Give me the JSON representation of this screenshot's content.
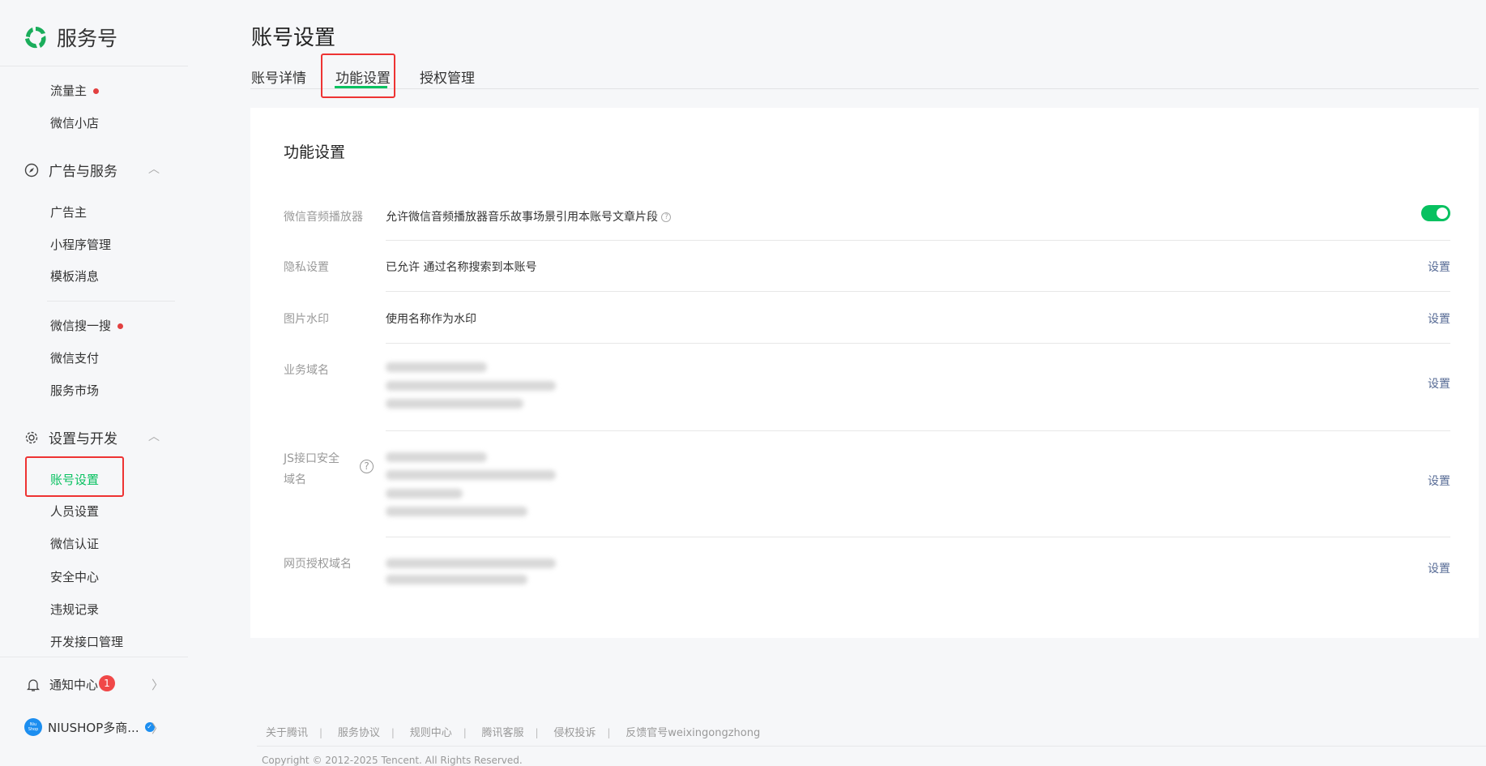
{
  "sidebar": {
    "brand": "服务号",
    "items_top": [
      {
        "label": "流量主",
        "dot": true
      },
      {
        "label": "微信小店"
      }
    ],
    "group_ads": {
      "label": "广告与服务",
      "items": [
        {
          "label": "广告主"
        },
        {
          "label": "小程序管理"
        },
        {
          "label": "模板消息"
        },
        {
          "label": "微信搜一搜",
          "dot": true
        },
        {
          "label": "微信支付"
        },
        {
          "label": "服务市场"
        }
      ]
    },
    "group_settings": {
      "label": "设置与开发",
      "items": [
        {
          "label": "账号设置"
        },
        {
          "label": "人员设置"
        },
        {
          "label": "微信认证"
        },
        {
          "label": "安全中心"
        },
        {
          "label": "违规记录"
        },
        {
          "label": "开发接口管理"
        }
      ]
    },
    "notify": {
      "label": "通知中心",
      "badge": "1"
    },
    "account": {
      "name": "NIUSHOP多商...",
      "avatar_text": "Niu Shop"
    }
  },
  "header": {
    "title": "账号设置",
    "tabs": [
      "账号详情",
      "功能设置",
      "授权管理"
    ],
    "active_tab": 1
  },
  "card": {
    "title": "功能设置",
    "rows": [
      {
        "label": "微信音频播放器",
        "value": "允许微信音频播放器音乐故事场景引用本账号文章片段",
        "toggle": true
      },
      {
        "label": "隐私设置",
        "value": "已允许 通过名称搜索到本账号",
        "action": "设置"
      },
      {
        "label": "图片水印",
        "value": "使用名称作为水印",
        "action": "设置"
      },
      {
        "label": "业务域名",
        "action": "设置"
      },
      {
        "label": "JS接口安全域名",
        "action": "设置"
      },
      {
        "label": "网页授权域名",
        "action": "设置"
      }
    ]
  },
  "footer": {
    "links": [
      "关于腾讯",
      "服务协议",
      "规则中心",
      "腾讯客服",
      "侵权投诉",
      "反馈官号weixingongzhong"
    ],
    "copyright": "Copyright © 2012-2025 Tencent. All Rights Reserved."
  },
  "colors": {
    "accent": "#07c160",
    "highlight": "#e33333",
    "link": "#576b95"
  }
}
